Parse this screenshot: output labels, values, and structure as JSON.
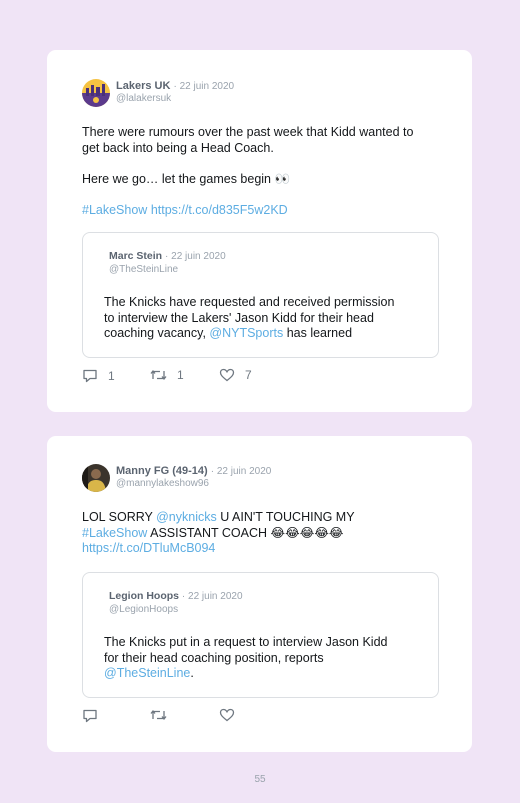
{
  "tweets": [
    {
      "author_name": "Lakers UK",
      "date": "· 22 juin 2020",
      "handle": "@lalakersuk",
      "text_line1": "There were rumours over the past week that Kidd wanted to",
      "text_line2": "get back into being a Head Coach.",
      "text_line3": "Here we go… let the games begin 👀",
      "hashtag": "#LakeShow",
      "url": "https://t.co/d835F5w2KD",
      "avatar_label": "LAKERS UK",
      "quote": {
        "author_name": "Marc Stein",
        "date": "· 22 juin 2020",
        "handle": "@TheSteinLine",
        "text_line1": "The Knicks have requested and received permission",
        "text_line2": "to interview the Lakers' Jason Kidd for their head",
        "text_line3_pre": "coaching vacancy, ",
        "mention": "@NYTSports",
        "text_line3_post": " has learned"
      },
      "replies": "1",
      "retweets": "1",
      "likes": "7"
    },
    {
      "author_name": "Manny FG (49-14)",
      "date": "· 22 juin 2020",
      "handle": "@mannylakeshow96",
      "text_line1_pre": "LOL SORRY ",
      "mention": "@nyknicks",
      "text_line1_post": " U AIN'T TOUCHING MY",
      "hashtag": "#LakeShow",
      "text_line2_post": " ASSISTANT COACH 😂😂😂😂😂",
      "url": "https://t.co/DTluMcB094",
      "quote": {
        "author_name": "Legion Hoops",
        "date": "· 22 juin 2020",
        "handle": "@LegionHoops",
        "text_line1": "The Knicks put in a request to interview Jason Kidd",
        "text_line2": "for their head coaching position, reports",
        "mention": "@TheSteinLine",
        "text_line3_post": "."
      }
    }
  ],
  "page_number": "55",
  "colors": {
    "background": "#f0e4f6",
    "card": "#ffffff",
    "link": "#5dade2",
    "muted": "#9aa3ad",
    "name": "#5b6470"
  },
  "icons": [
    "reply-icon",
    "retweet-icon",
    "like-icon"
  ]
}
